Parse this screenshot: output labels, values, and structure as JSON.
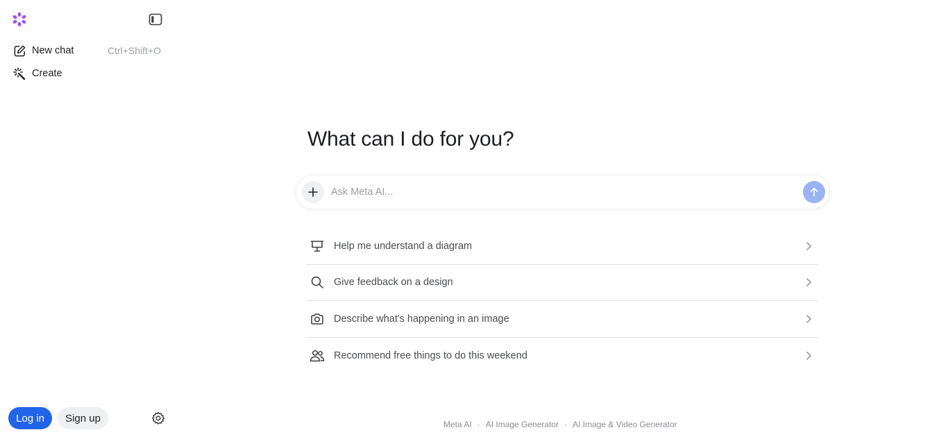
{
  "sidebar": {
    "logo_icon": "meta-ai-flower-icon",
    "toggle_icon": "sidebar-toggle-icon",
    "items": [
      {
        "label": "New chat",
        "icon": "edit-icon",
        "shortcut": "Ctrl+Shift+O"
      },
      {
        "label": "Create",
        "icon": "magic-wand-icon"
      }
    ],
    "login_label": "Log in",
    "signup_label": "Sign up",
    "settings_icon": "gear-icon"
  },
  "main": {
    "heading": "What can I do for you?",
    "composer": {
      "placeholder": "Ask Meta AI...",
      "plus_icon": "plus-icon",
      "send_icon": "arrow-up-icon"
    },
    "suggestions": [
      {
        "label": "Help me understand a diagram",
        "icon": "presentation-board-icon"
      },
      {
        "label": "Give feedback on a design",
        "icon": "search-icon"
      },
      {
        "label": "Describe what's happening in an image",
        "icon": "camera-icon"
      },
      {
        "label": "Recommend free things to do this weekend",
        "icon": "people-icon"
      }
    ]
  },
  "footer": {
    "links": [
      "Meta AI",
      "AI Image Generator",
      "AI Image & Video Generator"
    ],
    "separator": "·"
  },
  "colors": {
    "accent": "#2164e8",
    "send_button": "#9bb3f2",
    "logo_gradient": [
      "#3b6df5",
      "#a64cf0",
      "#e05fc4"
    ]
  }
}
